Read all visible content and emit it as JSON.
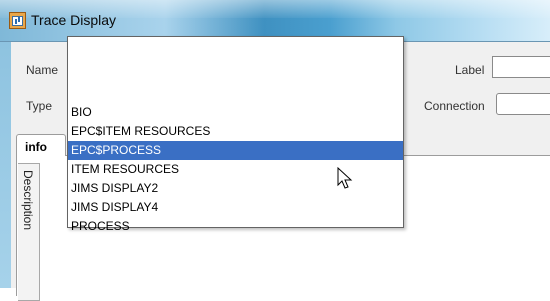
{
  "window": {
    "title": "Trace Display",
    "icon": "app-window-icon"
  },
  "form": {
    "name_label": "Name",
    "name_value": "",
    "label_label": "Label",
    "label_value": "",
    "type_label": "Type",
    "connection_label": "Connection",
    "connection_value": ""
  },
  "tabs": [
    {
      "label": "info",
      "active": true
    }
  ],
  "side_tab": {
    "label": "Description"
  },
  "dropdown": {
    "items": [
      {
        "label": ""
      },
      {
        "label": "BIO"
      },
      {
        "label": "EPC$ITEM RESOURCES"
      },
      {
        "label": "EPC$PROCESS",
        "selected": true
      },
      {
        "label": "ITEM RESOURCES"
      },
      {
        "label": "JIMS DISPLAY2"
      },
      {
        "label": "JIMS DISPLAY4"
      },
      {
        "label": "PROCESS"
      }
    ]
  },
  "colors": {
    "selection": "#3a6fc4",
    "titlebar": "#4a9fcf",
    "panel": "#f0f0f0"
  }
}
